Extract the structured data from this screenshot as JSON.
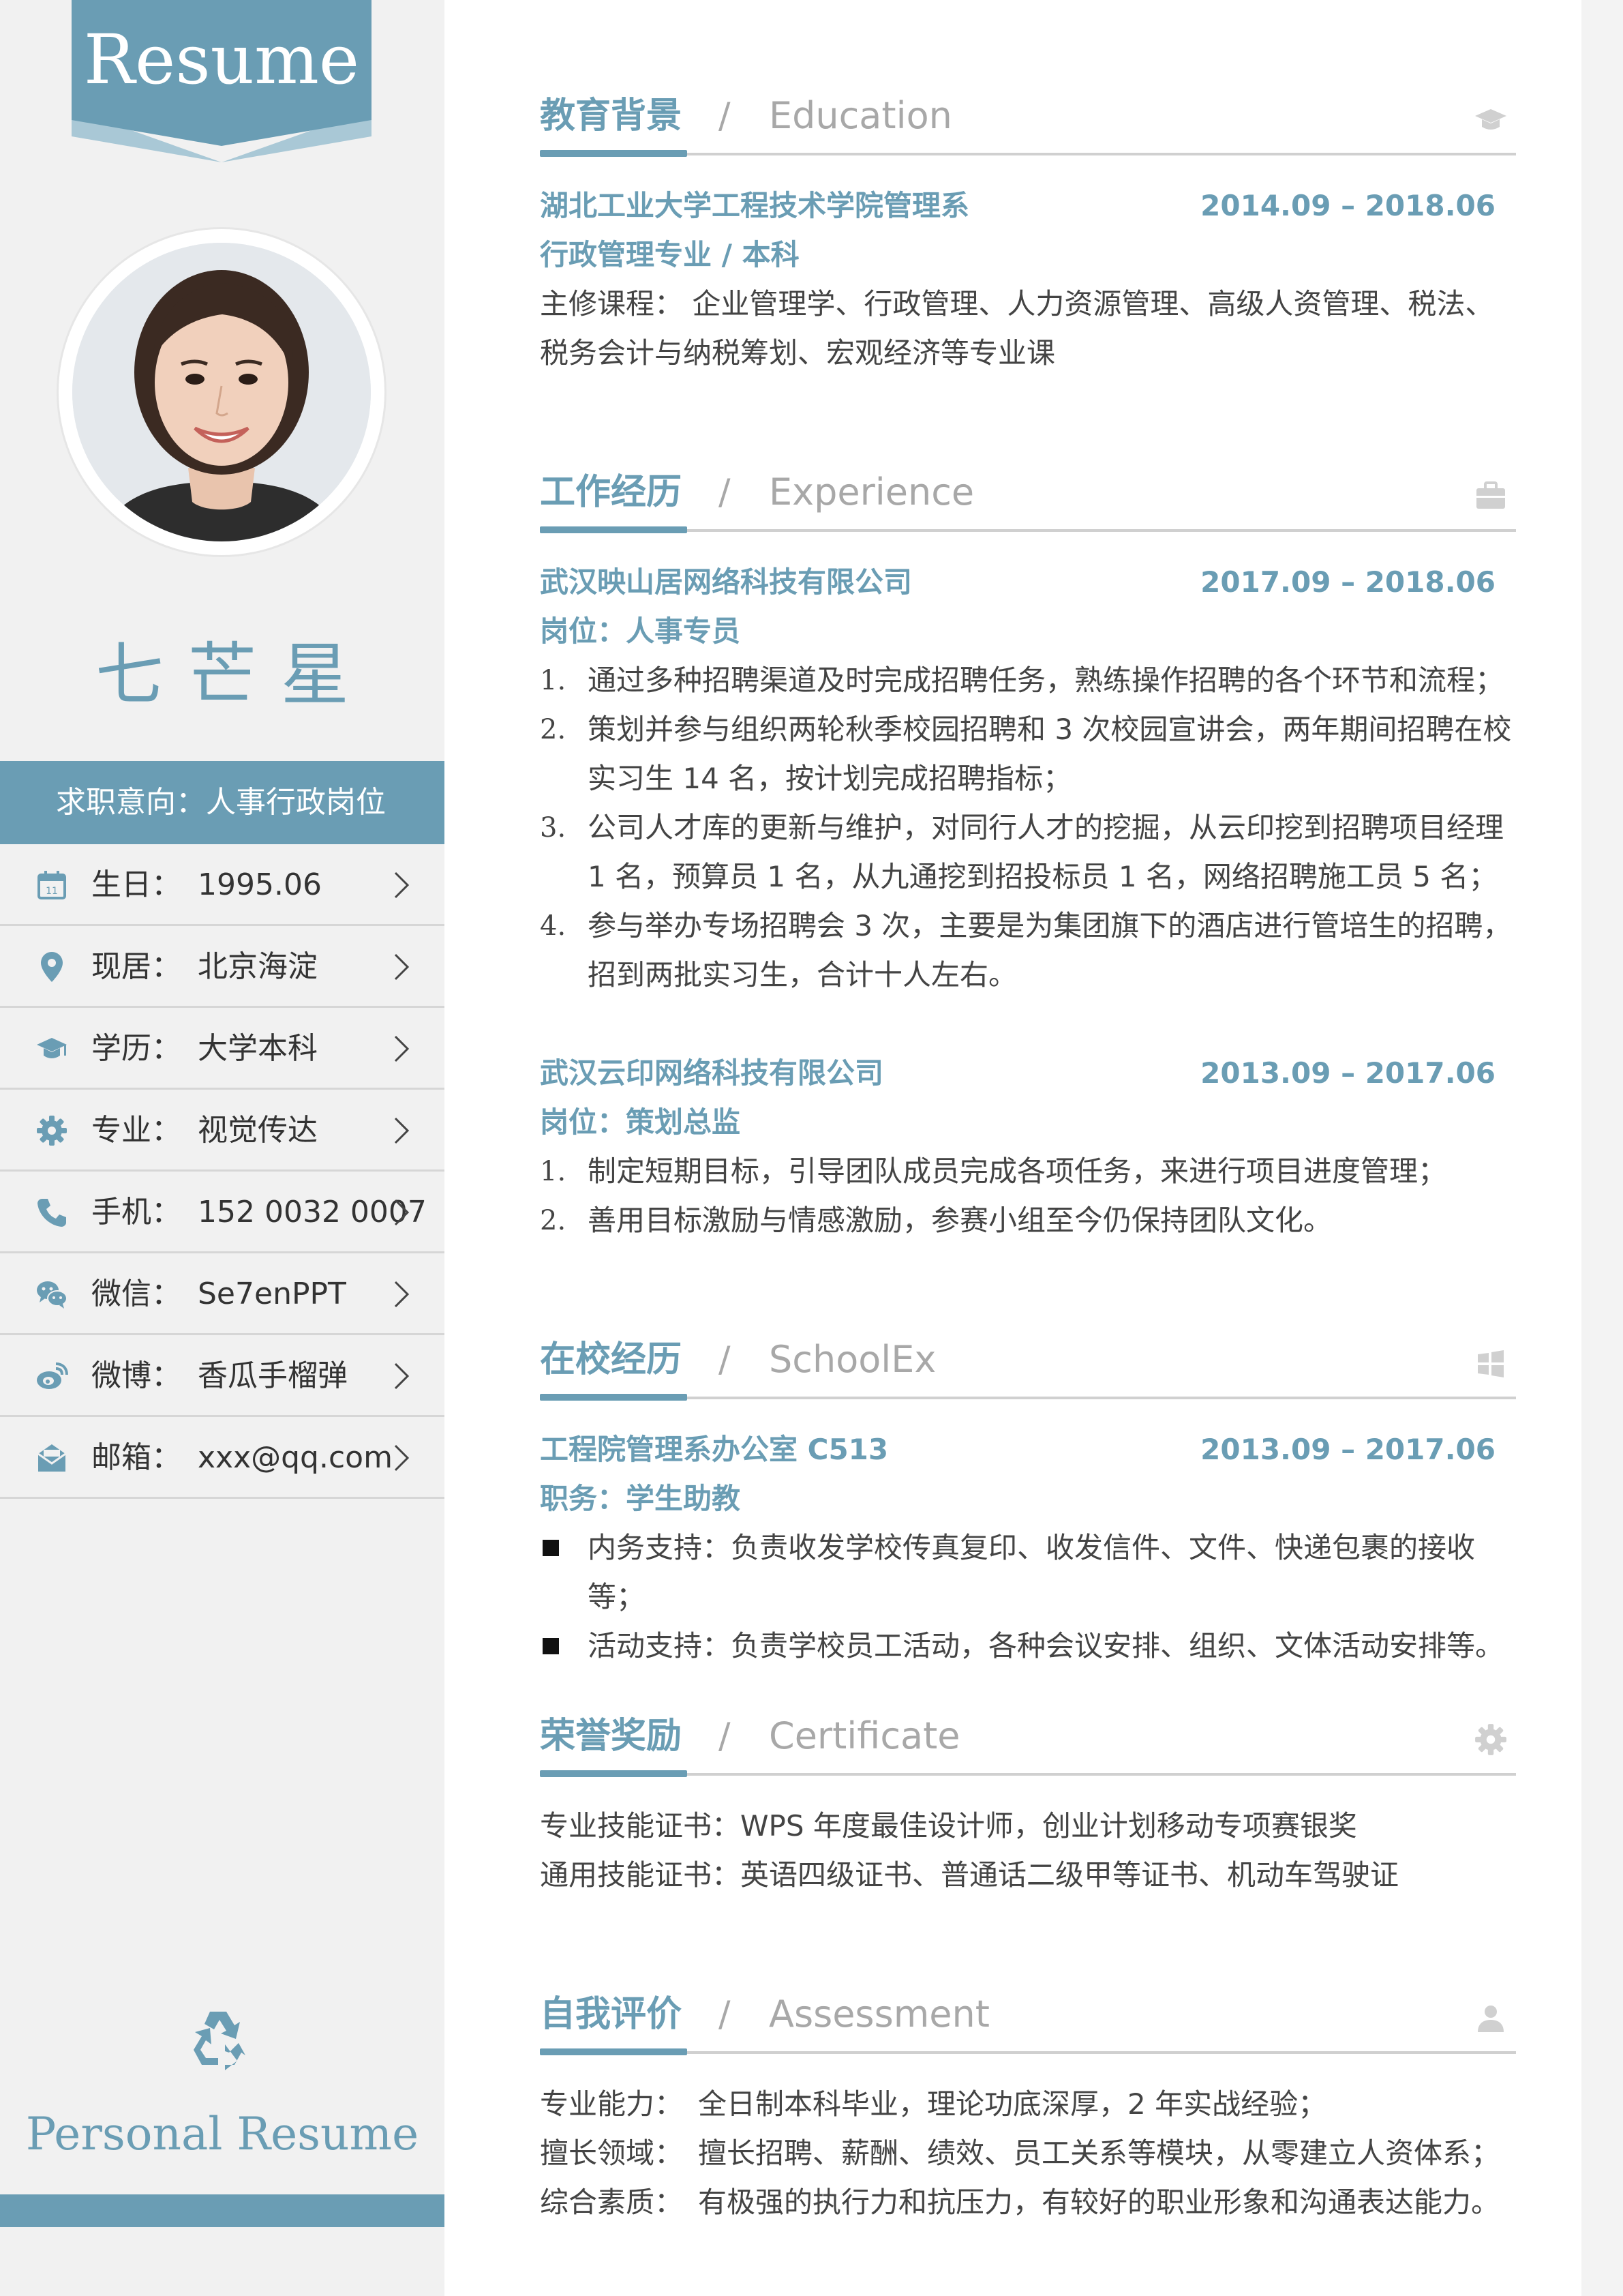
{
  "sidebar": {
    "banner_text": "Resume",
    "name": "七芒星",
    "intention": "求职意向：人事行政岗位",
    "info": [
      {
        "icon": "calendar-icon",
        "label": "生日：",
        "value": "1995.06"
      },
      {
        "icon": "location-pin-icon",
        "label": "现居：",
        "value": "北京海淀"
      },
      {
        "icon": "graduation-cap-icon",
        "label": "学历：",
        "value": "大学本科"
      },
      {
        "icon": "gear-icon",
        "label": "专业：",
        "value": "视觉传达"
      },
      {
        "icon": "phone-icon",
        "label": "手机：",
        "value": "152 0032 0007"
      },
      {
        "icon": "wechat-icon",
        "label": "微信：",
        "value": "Se7enPPT"
      },
      {
        "icon": "weibo-icon",
        "label": "微博：",
        "value": "香瓜手榴弹"
      },
      {
        "icon": "mail-icon",
        "label": "邮箱：",
        "value": "xxx@qq.com"
      }
    ],
    "footer_title": "Personal Resume"
  },
  "sections": {
    "education": {
      "cn": "教育背景",
      "slash": "/",
      "en": "Education",
      "icon": "graduation-cap-icon",
      "school": "湖北工业大学工程技术学院管理系",
      "date": "2014.09 – 2018.06",
      "major": "行政管理专业 / 本科",
      "courses_line1": "主修课程：  企业管理学、行政管理、人力资源管理、高级人资管理、税法、",
      "courses_line2": "税务会计与纳税筹划、宏观经济等专业课"
    },
    "experience": {
      "cn": "工作经历",
      "slash": "/",
      "en": "Experience",
      "icon": "briefcase-icon",
      "jobs": [
        {
          "company": "武汉映山居网络科技有限公司",
          "date": "2017.09 – 2018.06",
          "position": "岗位：人事专员",
          "items": [
            {
              "num": "1.",
              "lines": [
                "通过多种招聘渠道及时完成招聘任务，熟练操作招聘的各个环节和流程；"
              ]
            },
            {
              "num": "2.",
              "lines": [
                "策划并参与组织两轮秋季校园招聘和 3 次校园宣讲会，两年期间招聘在校",
                "实习生 14 名，按计划完成招聘指标；"
              ]
            },
            {
              "num": "3.",
              "lines": [
                "公司人才库的更新与维护，对同行人才的挖掘，从云印挖到招聘项目经理",
                "1 名，预算员 1 名，从九通挖到招投标员 1 名，网络招聘施工员 5 名；"
              ]
            },
            {
              "num": "4.",
              "lines": [
                "参与举办专场招聘会 3 次，主要是为集团旗下的酒店进行管培生的招聘，",
                "招到两批实习生，合计十人左右。"
              ]
            }
          ]
        },
        {
          "company": "武汉云印网络科技有限公司",
          "date": "2013.09 – 2017.06",
          "position": "岗位：策划总监",
          "items": [
            {
              "num": "1.",
              "lines": [
                "制定短期目标，引导团队成员完成各项任务，来进行项目进度管理；"
              ]
            },
            {
              "num": "2.",
              "lines": [
                "善用目标激励与情感激励，参赛小组至今仍保持团队文化。"
              ]
            }
          ]
        }
      ]
    },
    "school": {
      "cn": "在校经历",
      "slash": "/",
      "en": "SchoolEx",
      "icon": "windows-icon",
      "org": "工程院管理系办公室 C513",
      "date": "2013.09 – 2017.06",
      "role": "职务：学生助教",
      "items": [
        "内务支持：负责收发学校传真复印、收发信件、文件、快递包裹的接收等；",
        "活动支持：负责学校员工活动，各种会议安排、组织、文体活动安排等。"
      ]
    },
    "certificate": {
      "cn": "荣誉奖励",
      "slash": "/",
      "en": "Certificate",
      "icon": "gear-icon",
      "lines": [
        "专业技能证书：WPS 年度最佳设计师，创业计划移动专项赛银奖",
        "通用技能证书：英语四级证书、普通话二级甲等证书、机动车驾驶证"
      ]
    },
    "assessment": {
      "cn": "自我评价",
      "slash": "/",
      "en": "Assessment",
      "icon": "user-icon",
      "rows": [
        {
          "k": "专业能力：",
          "v": "全日制本科毕业，理论功底深厚，2  年实战经验；"
        },
        {
          "k": "擅长领域：",
          "v": "擅长招聘、薪酬、绩效、员工关系等模块，从零建立人资体系；"
        },
        {
          "k": "综合素质：",
          "v": "有极强的执行力和抗压力，有较好的职业形象和沟通表达能力。"
        }
      ]
    }
  },
  "colors": {
    "accent": "#6a9db4",
    "banner_light": "#a9c8d6",
    "muted": "#a8a8a8"
  }
}
